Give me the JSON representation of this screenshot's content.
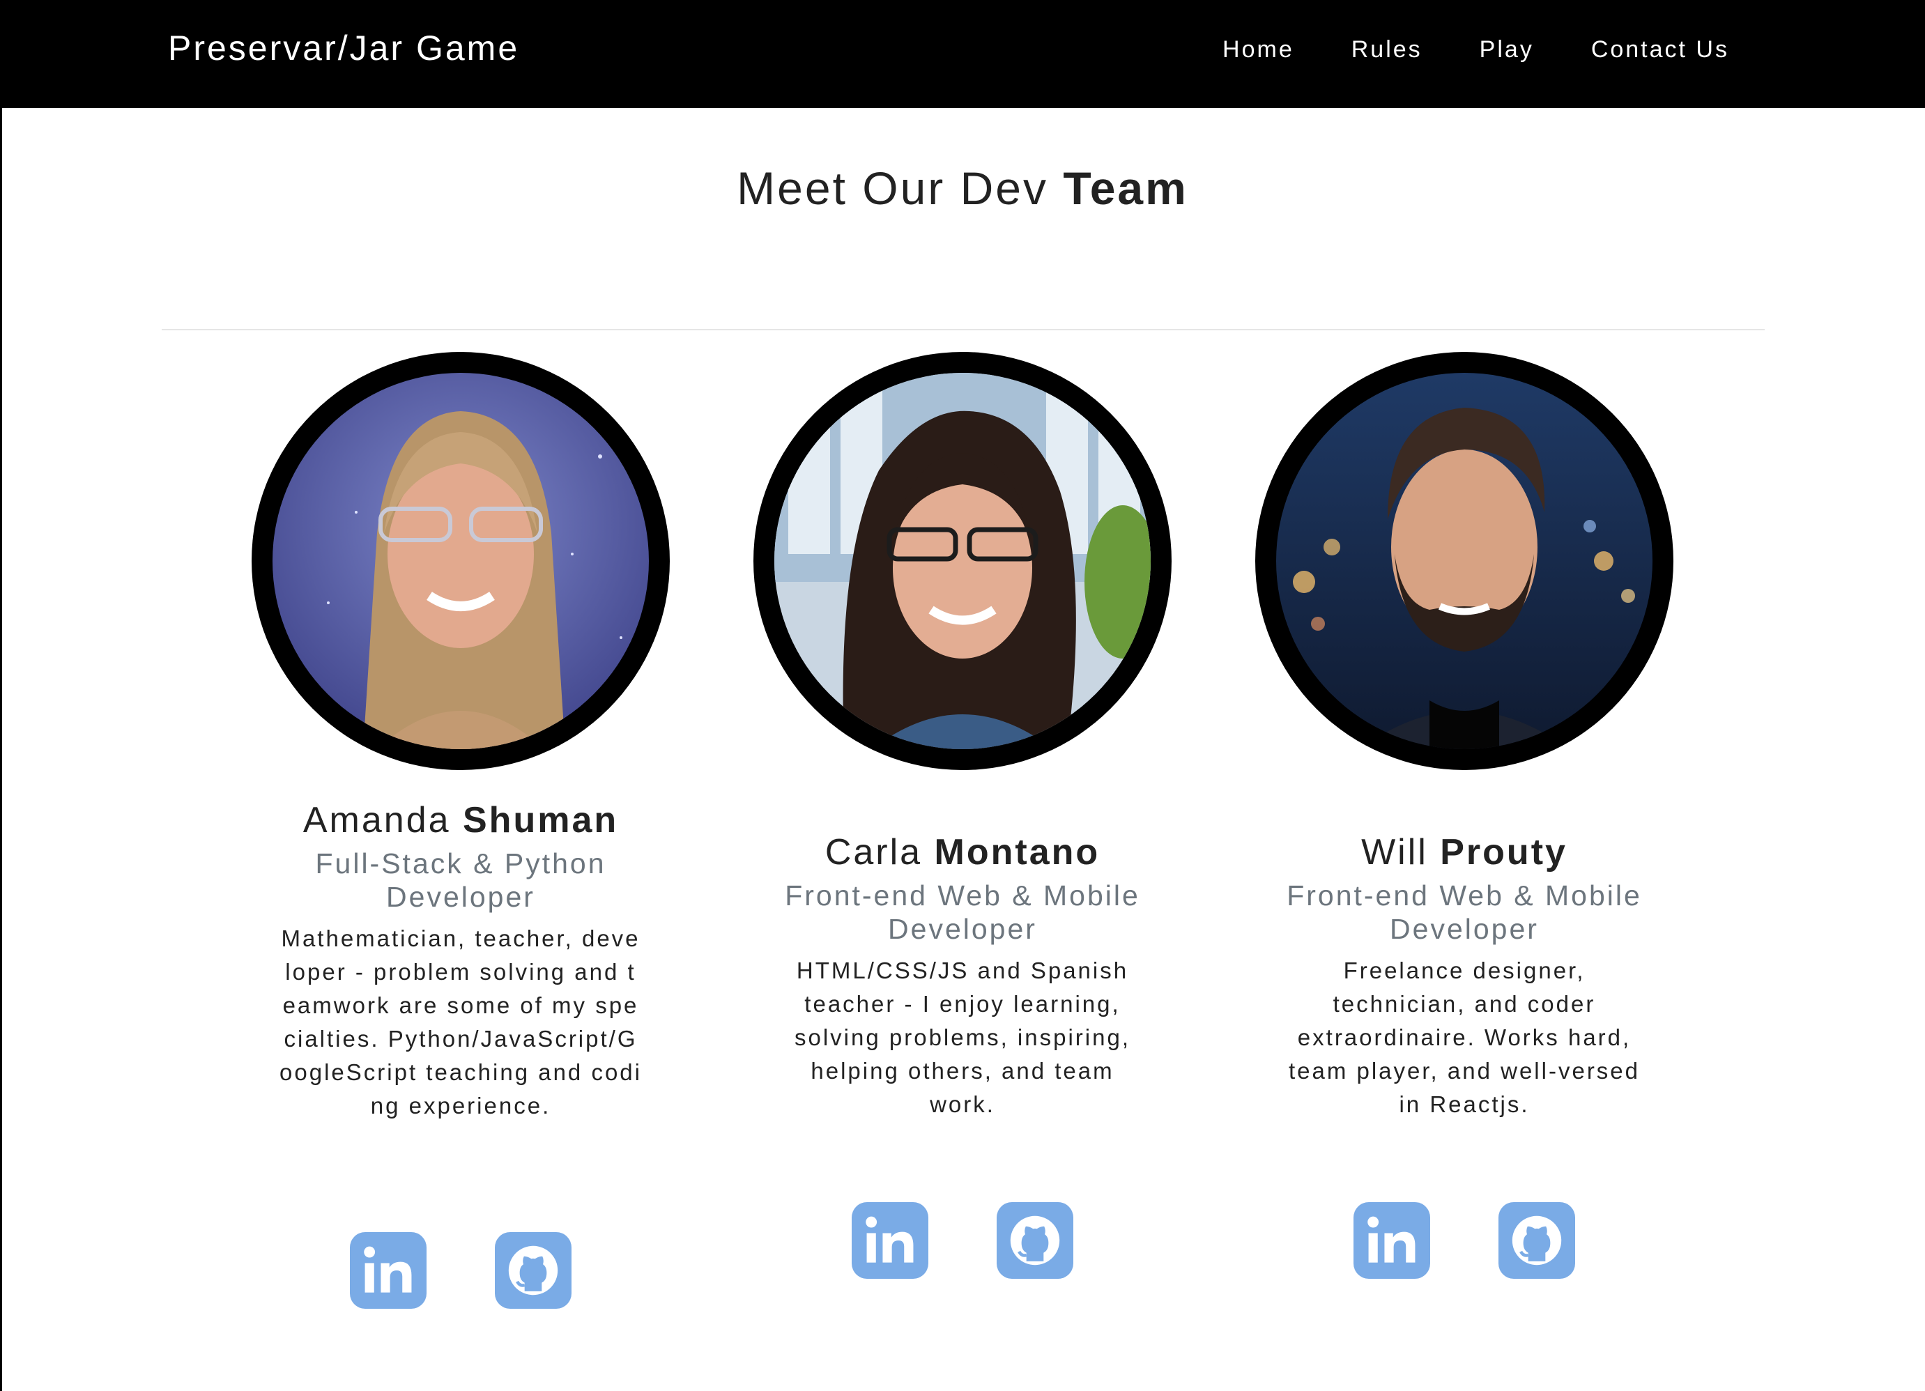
{
  "colors": {
    "navbar_bg": "#000000",
    "accent_icon": "#7aabe6",
    "role_text": "#6c757d",
    "text": "#222222"
  },
  "navbar": {
    "brand": "Preservar/Jar Game",
    "links": [
      {
        "label": "Home"
      },
      {
        "label": "Rules"
      },
      {
        "label": "Play"
      },
      {
        "label": "Contact Us"
      }
    ]
  },
  "section": {
    "title_regular": "Meet Our Dev ",
    "title_bold": "Team"
  },
  "team": [
    {
      "first_name": "Amanda ",
      "last_name": "Shuman",
      "role": "Full-Stack & Python Developer",
      "description": "Mathematician, teacher, developer - problem solving and teamwork are some of my specialties. Python/JavaScript/GoogleScript teaching and coding experience.",
      "photo": "portrait-photo",
      "social": [
        "linkedin-icon",
        "github-icon"
      ]
    },
    {
      "first_name": "Carla ",
      "last_name": "Montano",
      "role": "Front-end Web & Mobile Developer",
      "description": "HTML/CSS/JS and Spanish teacher - I enjoy learning, solving problems, inspiring, helping others, and team work.",
      "photo": "portrait-photo",
      "social": [
        "linkedin-icon",
        "github-icon"
      ]
    },
    {
      "first_name": "Will ",
      "last_name": "Prouty",
      "role": "Front-end Web & Mobile Developer",
      "description": "Freelance designer, technician, and coder extraordinaire. Works hard, team player, and well-versed in Reactjs.",
      "photo": "portrait-photo",
      "social": [
        "linkedin-icon",
        "github-icon"
      ]
    }
  ]
}
